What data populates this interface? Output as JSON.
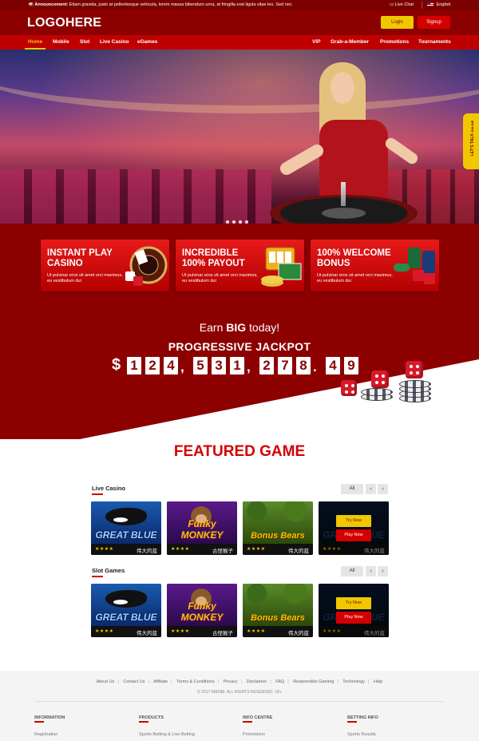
{
  "announcement": {
    "label": "Announcement:",
    "text": "Etiam gravida, justo at pellentesque vehicula, lorem massa bibendum urna, at fringilla erat ligula vitae leo. Sed nec",
    "live_chat": "Live Chat",
    "language": "English"
  },
  "header": {
    "logo": "LOGOHERE",
    "login": "Login",
    "signup": "Signup"
  },
  "nav": {
    "left": [
      "Home",
      "Mobile",
      "Slot",
      "Live Casino",
      "eGames"
    ],
    "right": [
      "VIP",
      "Grab-a-Member",
      "Promotions",
      "Tournaments"
    ],
    "active": "Home"
  },
  "chat_tab": {
    "line1": "LET'S TALK",
    "line2": "ONLINE"
  },
  "promos": [
    {
      "title": "INSTANT PLAY CASINO",
      "desc": "Ut pulvinar eros sit amet orci maximus, eu vestibulum dui"
    },
    {
      "title": "INCREDIBLE 100% PAYOUT",
      "desc": "Ut pulvinar eros sit amet orci maximus, eu vestibulum dui"
    },
    {
      "title": "100% WELCOME BONUS",
      "desc": "Ut pulvinar eros sit amet orci maximus, eu vestibulum dui"
    }
  ],
  "jackpot": {
    "earn_pre": "Earn ",
    "earn_big": "BIG",
    "earn_post": " today!",
    "title": "PROGRESSIVE JACKPOT",
    "currency": "$",
    "digits": [
      "1",
      "2",
      "4",
      "5",
      "3",
      "1",
      "2",
      "7",
      "8",
      "4",
      "9"
    ]
  },
  "featured": {
    "title": "FEATURED GAME",
    "all": "All",
    "prev": "‹",
    "next": "›",
    "try_now": "Try Now",
    "play_now": "Play Now",
    "sections": [
      {
        "title": "Live Casino",
        "games": [
          {
            "art": "GREAT BLUE",
            "stars": "★★★★",
            "name": "伟大的蓝"
          },
          {
            "art": "Funky MONKEY",
            "stars": "★★★★",
            "name": "古怪猴子"
          },
          {
            "art": "Bonus Bears",
            "stars": "★★★★",
            "name": "伟大的蓝"
          },
          {
            "art": "GREAT BLUE",
            "stars": "★★★★",
            "name": "伟大的蓝"
          }
        ]
      },
      {
        "title": "Slot Games",
        "games": [
          {
            "art": "GREAT BLUE",
            "stars": "★★★★",
            "name": "伟大的蓝"
          },
          {
            "art": "Funky MONKEY",
            "stars": "★★★★",
            "name": "古怪猴子"
          },
          {
            "art": "Bonus Bears",
            "stars": "★★★★",
            "name": "伟大的蓝"
          },
          {
            "art": "GREAT BLUE",
            "stars": "★★★★",
            "name": "伟大的蓝"
          }
        ]
      }
    ]
  },
  "footer": {
    "links": [
      "About Us",
      "Contact Us",
      "Affiliate",
      "Terms & Conditions",
      "Privacy",
      "Disclaimer",
      "FAQ",
      "Responsible Gaming",
      "Technology",
      "Help"
    ],
    "copyright": "© 2017 MAX88. ALL RIGHTS RESERVED. 18+",
    "columns": [
      {
        "heading": "INFORMATION",
        "item": "Registration"
      },
      {
        "heading": "PRODUCTS",
        "item": "Sports Betting & Live Betting"
      },
      {
        "heading": "INFO CENTRE",
        "item": "Promotions"
      },
      {
        "heading": "BETTING INFO",
        "item": "Sports Results"
      }
    ]
  },
  "colors": {
    "primary": "#8c0000",
    "accent": "#f0c800",
    "nav": "#c00000",
    "promo": "#d40000"
  }
}
